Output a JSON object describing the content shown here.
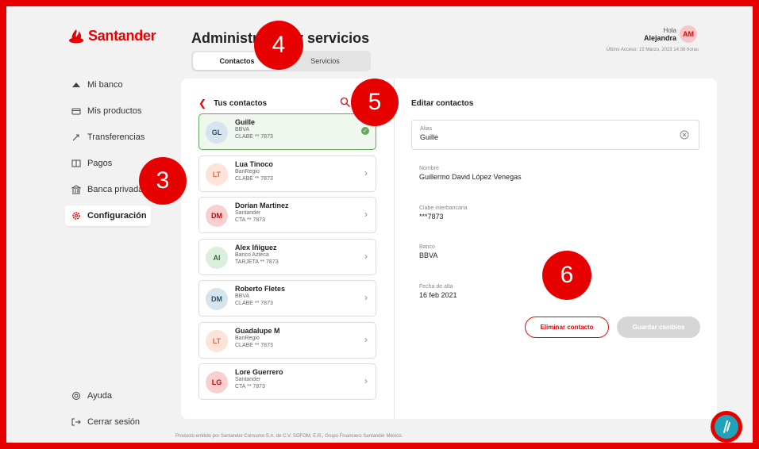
{
  "brand": {
    "name": "Santander",
    "color": "#ec0000"
  },
  "nav": {
    "items": [
      {
        "label": "Mi banco",
        "icon": "bank-icon"
      },
      {
        "label": "Mis productos",
        "icon": "card-icon"
      },
      {
        "label": "Transferencias",
        "icon": "transfer-icon"
      },
      {
        "label": "Pagos",
        "icon": "payments-icon"
      },
      {
        "label": "Banca privada",
        "icon": "building-icon"
      },
      {
        "label": "Configuración",
        "icon": "gear-icon",
        "active": true
      }
    ],
    "bottom": [
      {
        "label": "Ayuda",
        "icon": "help-icon"
      },
      {
        "label": "Cerrar sesión",
        "icon": "logout-icon"
      }
    ]
  },
  "header": {
    "title": "Administra   tos y servicios",
    "tabs": [
      "Contactos",
      "Servicios"
    ],
    "greeting": "Hola",
    "user_name": "Alejandra",
    "user_initials": "AM",
    "last_access": "Último Acceso: 15 Marzo, 2023 14:36 horas"
  },
  "list": {
    "title": "Tus contactos",
    "contacts": [
      {
        "initials": "GL",
        "name": "Guille",
        "bank": "BBVA",
        "account": "CLABE ** 7873",
        "avatar_bg": "#d6e4ee",
        "avatar_fg": "#2a4f6e",
        "selected": true
      },
      {
        "initials": "LT",
        "name": "Lua Tinoco",
        "bank": "BanRegio",
        "account": "CLABE ** 7873",
        "avatar_bg": "#fde3d8",
        "avatar_fg": "#e06b3f"
      },
      {
        "initials": "DM",
        "name": "Dorian Martinez",
        "bank": "Santander",
        "account": "CTA ** 7873",
        "avatar_bg": "#f9d0d0",
        "avatar_fg": "#d00000"
      },
      {
        "initials": "AI",
        "name": "Alex Iñiguez",
        "bank": "Banco Azteca",
        "account": "TARJETA ** 7873",
        "avatar_bg": "#dcefdc",
        "avatar_fg": "#2f6b3a"
      },
      {
        "initials": "DM",
        "name": "Roberto Fletes",
        "bank": "BBVA",
        "account": "CLABE ** 7873",
        "avatar_bg": "#d6e4ee",
        "avatar_fg": "#2a4f6e"
      },
      {
        "initials": "LT",
        "name": "Guadalupe M",
        "bank": "BanRegio",
        "account": "CLABE ** 7873",
        "avatar_bg": "#fde3d8",
        "avatar_fg": "#e06b3f"
      },
      {
        "initials": "LG",
        "name": "Lore Guerrero",
        "bank": "Santander",
        "account": "CTA ** 7873",
        "avatar_bg": "#f9d0d0",
        "avatar_fg": "#d00000"
      }
    ]
  },
  "editor": {
    "title": "Editar contactos",
    "alias_label": "Alias",
    "alias_value": "Guille",
    "fields": [
      {
        "label": "Nombre",
        "value": "Guillermo David López Venegas"
      },
      {
        "label": "Clabe interbancaria",
        "value": "***7873"
      },
      {
        "label": "Banco",
        "value": "BBVA"
      },
      {
        "label": "Fecha de alta",
        "value": "16 feb 2021"
      }
    ],
    "delete_label": "Eliminar contacto",
    "save_label": "Guardar cambios"
  },
  "markers": [
    "3",
    "4",
    "5",
    "6"
  ],
  "footer": "Producto emitido por Santander Consumo S.A. de C.V. SOFOM, E.R., Grupo Financiero Santander México."
}
